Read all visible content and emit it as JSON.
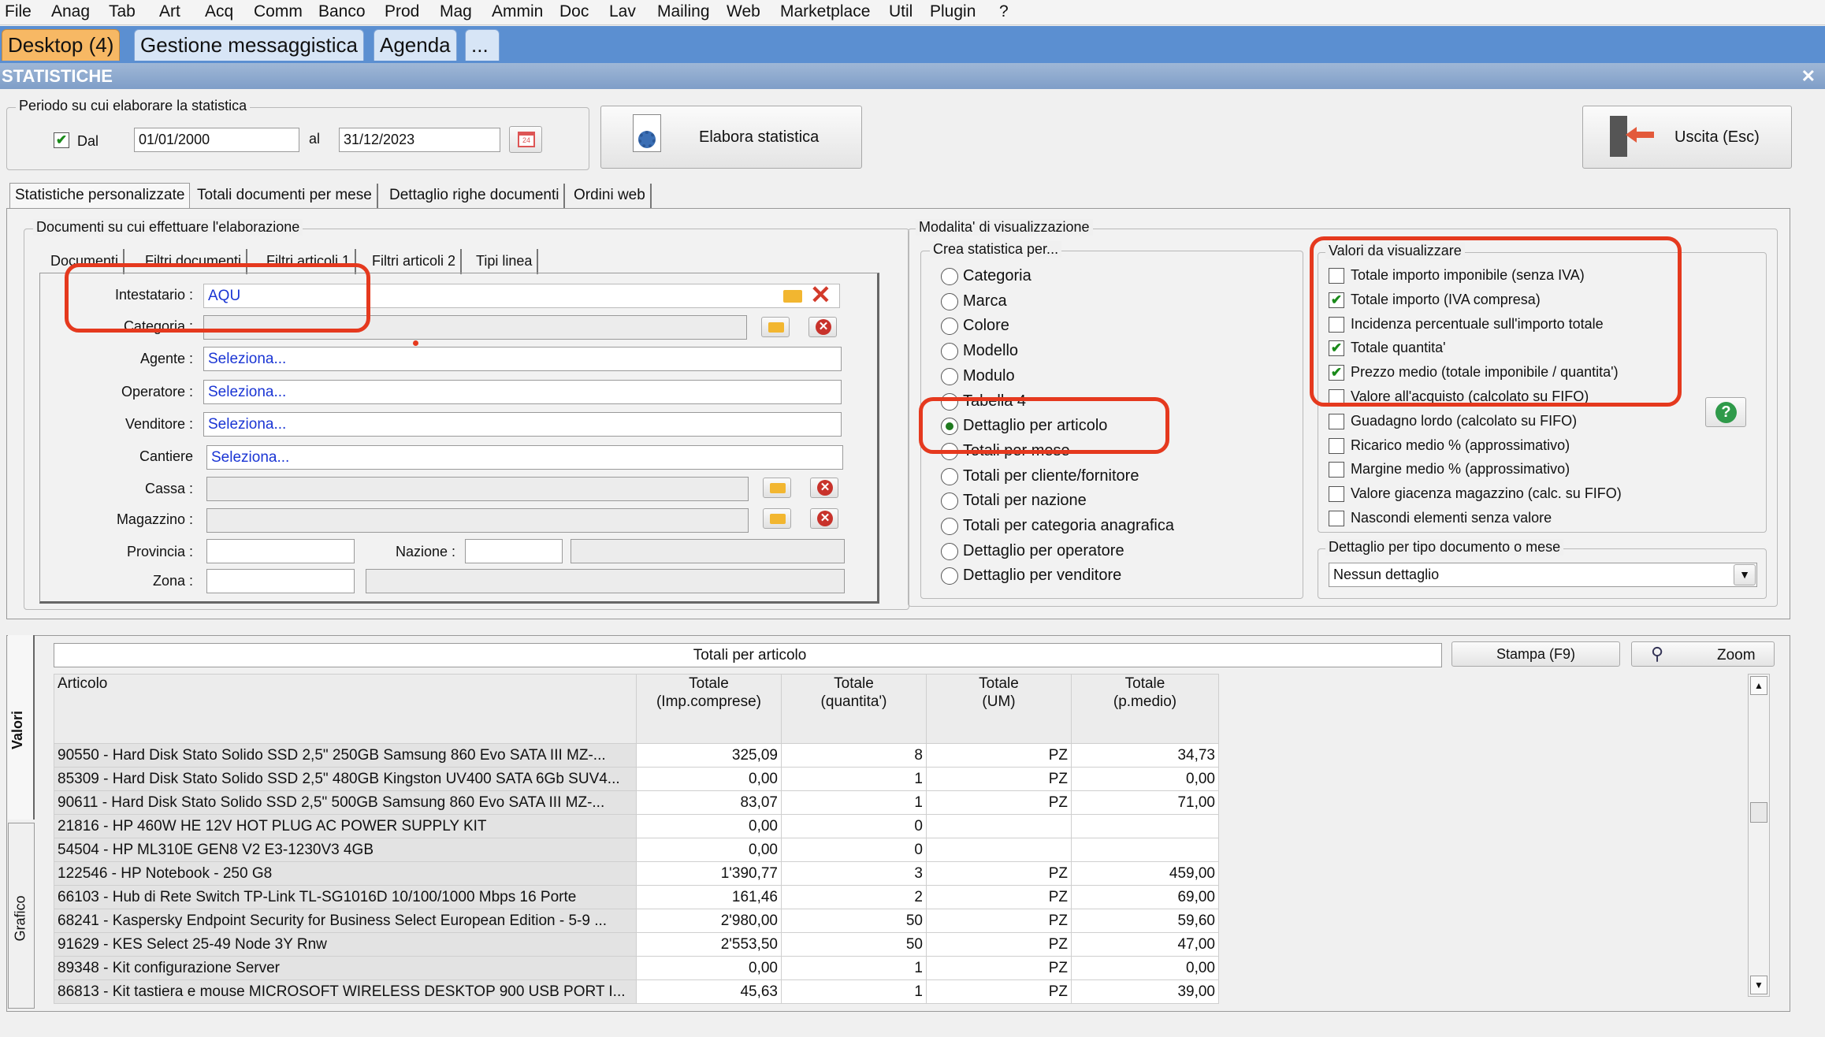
{
  "menu": [
    "File",
    "Anag",
    "Tab",
    "Art",
    "Acq",
    "Comm",
    "Banco",
    "Prod",
    "Mag",
    "Ammin",
    "Doc",
    "Lav",
    "Mailing",
    "Web",
    "Marketplace",
    "Util",
    "Plugin",
    "?"
  ],
  "app_tabs": [
    "Desktop (4)",
    "Gestione messaggistica",
    "Agenda",
    "..."
  ],
  "window_title": "STATISTICHE",
  "period": {
    "group_label": "Periodo su cui elaborare la statistica",
    "dal_label": "Dal",
    "dal_checked": true,
    "dal_value": "01/01/2000",
    "al_label": "al",
    "al_value": "31/12/2023"
  },
  "buttons": {
    "elabora": "Elabora statistica",
    "uscita": "Uscita (Esc)",
    "stampa": "Stampa (F9)",
    "zoom": "Zoom"
  },
  "main_tabs": [
    "Statistiche personalizzate",
    "Totali documenti per mese",
    "Dettaglio righe documenti",
    "Ordini web"
  ],
  "docs": {
    "group_label": "Documenti su cui effettuare l'elaborazione",
    "subtabs": [
      "Documenti",
      "Filtri documenti",
      "Filtri articoli 1",
      "Filtri articoli 2",
      "Tipi linea"
    ],
    "intestatario_label": "Intestatario :",
    "intestatario_value": "AQU",
    "categoria_label": "Categoria :",
    "agente_label": "Agente :",
    "operatore_label": "Operatore :",
    "venditore_label": "Venditore :",
    "cantiere_label": "Cantiere",
    "seleziona": "Seleziona...",
    "cassa_label": "Cassa :",
    "magazzino_label": "Magazzino :",
    "provincia_label": "Provincia :",
    "nazione_label": "Nazione :",
    "zona_label": "Zona :"
  },
  "modalita": {
    "group_label": "Modalita' di visualizzazione",
    "crea_label": "Crea statistica per...",
    "options": [
      "Categoria",
      "Marca",
      "Colore",
      "Modello",
      "Modulo",
      "Tabella 4",
      "Dettaglio per articolo",
      "Totali per mese",
      "Totali per cliente/fornitore",
      "Totali per nazione",
      "Totali per categoria anagrafica",
      "Dettaglio per operatore",
      "Dettaglio per venditore"
    ],
    "selected": "Dettaglio per articolo"
  },
  "valori": {
    "group_label": "Valori da visualizzare",
    "options": [
      {
        "label": "Totale importo imponibile (senza IVA)",
        "checked": false
      },
      {
        "label": "Totale importo (IVA compresa)",
        "checked": true
      },
      {
        "label": "Incidenza percentuale sull'importo totale",
        "checked": false
      },
      {
        "label": "Totale quantita'",
        "checked": true
      },
      {
        "label": "Prezzo medio (totale imponibile / quantita')",
        "checked": true
      },
      {
        "label": "Valore all'acquisto (calcolato su FIFO)",
        "checked": false
      },
      {
        "label": "Guadagno lordo (calcolato su FIFO)",
        "checked": false
      },
      {
        "label": "Ricarico medio % (approssimativo)",
        "checked": false
      },
      {
        "label": "Margine medio % (approssimativo)",
        "checked": false
      },
      {
        "label": "Valore giacenza magazzino (calc. su FIFO)",
        "checked": false
      },
      {
        "label": "Nascondi elementi senza valore",
        "checked": false
      }
    ],
    "dettaglio_label": "Dettaglio per tipo documento o mese",
    "dettaglio_value": "Nessun dettaglio"
  },
  "results": {
    "side_tabs": [
      "Valori",
      "Grafico"
    ],
    "title": "Totali per articolo",
    "columns": [
      "Articolo",
      "Totale\n(Imp.comprese)",
      "Totale\n(quantita')",
      "Totale\n(UM)",
      "Totale\n(p.medio)"
    ],
    "rows": [
      [
        "90550 - Hard Disk Stato Solido SSD 2,5\" 250GB Samsung 860 Evo SATA III MZ-...",
        "325,09",
        "8",
        "PZ",
        "34,73"
      ],
      [
        "85309 - Hard Disk Stato Solido SSD 2,5\" 480GB Kingston UV400 SATA 6Gb SUV4...",
        "0,00",
        "1",
        "PZ",
        "0,00"
      ],
      [
        "90611 - Hard Disk Stato Solido SSD 2,5\" 500GB Samsung 860 Evo SATA III MZ-...",
        "83,07",
        "1",
        "PZ",
        "71,00"
      ],
      [
        "21816 - HP 460W HE 12V HOT PLUG AC POWER SUPPLY KIT",
        "0,00",
        "0",
        "",
        ""
      ],
      [
        "54504 - HP ML310E GEN8 V2 E3-1230V3 4GB",
        "0,00",
        "0",
        "",
        ""
      ],
      [
        "122546 - HP Notebook - 250 G8",
        "1'390,77",
        "3",
        "PZ",
        "459,00"
      ],
      [
        "66103 - Hub di Rete Switch TP-Link TL-SG1016D 10/100/1000 Mbps 16 Porte",
        "161,46",
        "2",
        "PZ",
        "69,00"
      ],
      [
        "68241 - Kaspersky Endpoint Security for Business Select European Edition - 5-9 ...",
        "2'980,00",
        "50",
        "PZ",
        "59,60"
      ],
      [
        "91629 - KES Select 25-49 Node 3Y Rnw",
        "2'553,50",
        "50",
        "PZ",
        "47,00"
      ],
      [
        "89348 - Kit configurazione Server",
        "0,00",
        "1",
        "PZ",
        "0,00"
      ],
      [
        "86813 - Kit tastiera e mouse MICROSOFT WIRELESS DESKTOP 900 USB PORT I...",
        "45,63",
        "1",
        "PZ",
        "39,00"
      ]
    ]
  },
  "colors": {
    "highlight": "#e5391e",
    "tabbar": "#5b8fd1",
    "active_tab": "#f7b864"
  }
}
